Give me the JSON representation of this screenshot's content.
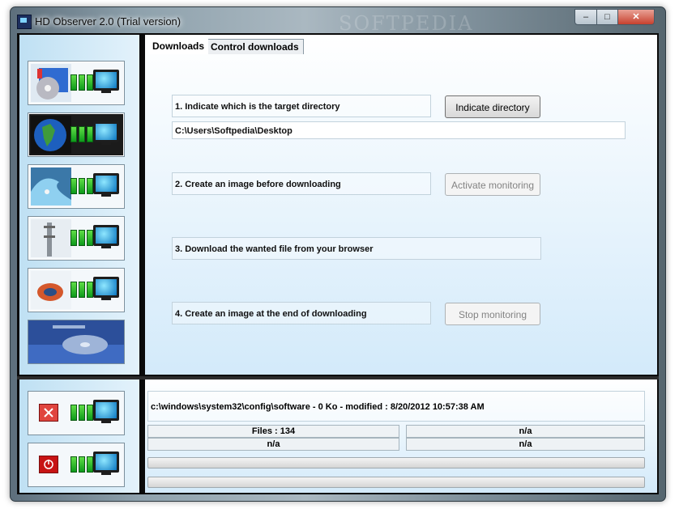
{
  "window": {
    "title": "HD Observer 2.0 (Trial version)",
    "watermark": "SOFTPEDIA",
    "controls": {
      "minimize": "–",
      "maximize": "□",
      "close": "✕"
    }
  },
  "sidebar": {
    "buttons": [
      {
        "name": "disk",
        "icon": "disk-icon"
      },
      {
        "name": "globe",
        "icon": "globe-icon"
      },
      {
        "name": "wave",
        "icon": "wave-icon"
      },
      {
        "name": "tower",
        "icon": "tower-icon"
      },
      {
        "name": "satellite",
        "icon": "satellite-icon"
      },
      {
        "name": "about",
        "icon": "about-icon"
      }
    ]
  },
  "tabs": [
    {
      "label": "Downloads",
      "active": true
    },
    {
      "label": "Control downloads",
      "active": false
    }
  ],
  "steps": {
    "step1": "1. Indicate which is the target directory",
    "step2": "2. Create an image before downloading",
    "step3": "3. Download the wanted file from your browser",
    "step4": "4. Create an image at the end of downloading"
  },
  "buttons": {
    "indicate": "Indicate directory",
    "activate": "Activate monitoring",
    "stop": "Stop monitoring"
  },
  "target_path": "C:\\Users\\Softpedia\\Desktop",
  "status": {
    "line": "c:\\windows\\system32\\config\\software - 0 Ko - modified : 8/20/2012 10:57:38 AM",
    "files": "Files : 134",
    "cell2": "n/a",
    "cell3": "n/a",
    "cell4": "n/a"
  },
  "colors": {
    "accent": "#d3eafa",
    "bars": "#2bbd2b"
  }
}
